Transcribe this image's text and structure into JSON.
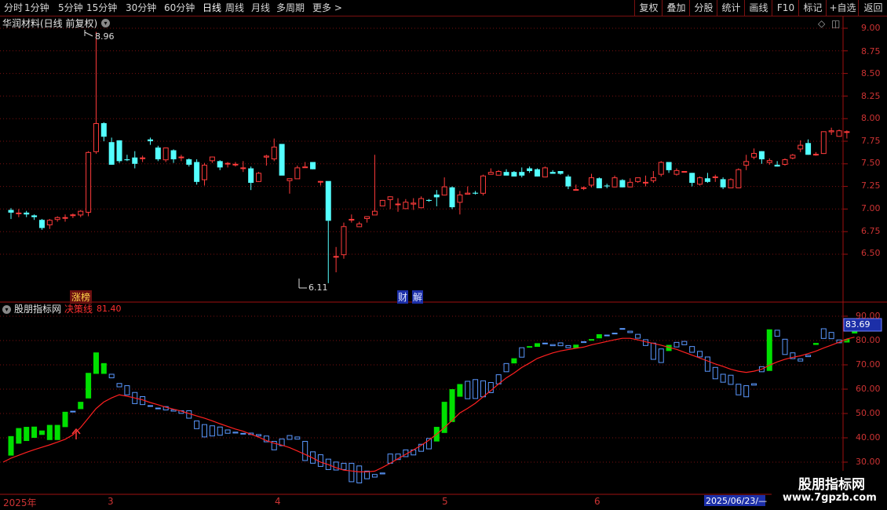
{
  "toolbar": {
    "periods": [
      "分时",
      "1分钟",
      "5分钟",
      "15分钟",
      "30分钟",
      "60分钟",
      "日线",
      "周线",
      "月线",
      "多周期",
      "更多 >"
    ],
    "active_period": "日线",
    "actions": [
      "复权",
      "叠加",
      "分股",
      "统计",
      "画线",
      "F10",
      "标记",
      "+自选",
      "返回"
    ]
  },
  "main_panel": {
    "title": "华润材料(日线 前复权)",
    "high_label": "8.96",
    "low_label": "6.11",
    "tag_limit": "涨榜",
    "tag_fin": "财",
    "tag_jie": "解"
  },
  "indicator_panel": {
    "name": "股朋指标网",
    "line_label": "决策线",
    "line_value": "81.40",
    "current_value": "83.69"
  },
  "price_axis": {
    "ticks": [
      "9.00",
      "8.75",
      "8.50",
      "8.25",
      "8.00",
      "7.75",
      "7.50",
      "7.25",
      "7.00",
      "6.75",
      "6.50"
    ]
  },
  "indicator_axis": {
    "ticks": [
      "90.00",
      "80.00",
      "70.00",
      "60.00",
      "50.00",
      "40.00",
      "30.00"
    ]
  },
  "date_axis": {
    "labels": [
      "2025年",
      "3",
      "4",
      "5",
      "6"
    ],
    "cursor_date": "2025/06/23/—"
  },
  "watermark": {
    "line1": "股朋指标网",
    "line2": "www.7gpzb.com"
  },
  "colors": {
    "up": "#ff3b3b",
    "down": "#54ffff",
    "grid": "#7a1010",
    "border": "#a01010",
    "decision_line": "#ff2020",
    "ind_up": "#5a98ff",
    "ind_down": "#00e000"
  },
  "chart_data": [
    {
      "type": "candlestick",
      "title": "华润材料(日线 前复权)",
      "ylim": [
        6.0,
        9.1
      ],
      "ohlc": [
        [
          6.99,
          6.96,
          6.89,
          7.01
        ],
        [
          6.95,
          6.96,
          6.91,
          7.0
        ],
        [
          6.96,
          6.94,
          6.91,
          6.98
        ],
        [
          6.93,
          6.91,
          6.88,
          6.94
        ],
        [
          6.88,
          6.79,
          6.77,
          6.89
        ],
        [
          6.82,
          6.88,
          6.78,
          6.89
        ],
        [
          6.88,
          6.91,
          6.86,
          6.92
        ],
        [
          6.91,
          6.91,
          6.86,
          6.94
        ],
        [
          6.94,
          6.94,
          6.9,
          6.95
        ],
        [
          6.93,
          6.98,
          6.91,
          6.99
        ],
        [
          6.96,
          7.63,
          6.92,
          7.64
        ],
        [
          7.63,
          7.95,
          7.61,
          8.96
        ],
        [
          7.95,
          7.8,
          7.75,
          7.96
        ],
        [
          7.74,
          7.49,
          7.49,
          7.79
        ],
        [
          7.76,
          7.53,
          7.51,
          7.76
        ],
        [
          7.55,
          7.54,
          7.53,
          7.6
        ],
        [
          7.57,
          7.5,
          7.45,
          7.64
        ],
        [
          7.56,
          7.57,
          7.52,
          7.59
        ],
        [
          7.77,
          7.75,
          7.71,
          7.79
        ],
        [
          7.68,
          7.55,
          7.53,
          7.7
        ],
        [
          7.54,
          7.68,
          7.52,
          7.68
        ],
        [
          7.65,
          7.55,
          7.51,
          7.66
        ],
        [
          7.58,
          7.58,
          7.53,
          7.6
        ],
        [
          7.55,
          7.49,
          7.47,
          7.56
        ],
        [
          7.52,
          7.3,
          7.27,
          7.55
        ],
        [
          7.32,
          7.49,
          7.26,
          7.51
        ],
        [
          7.53,
          7.58,
          7.51,
          7.58
        ],
        [
          7.53,
          7.46,
          7.43,
          7.54
        ],
        [
          7.5,
          7.51,
          7.46,
          7.52
        ],
        [
          7.5,
          7.5,
          7.47,
          7.52
        ],
        [
          7.45,
          7.46,
          7.41,
          7.53
        ],
        [
          7.45,
          7.29,
          7.21,
          7.47
        ],
        [
          7.3,
          7.4,
          7.3,
          7.41
        ],
        [
          7.57,
          7.59,
          7.48,
          7.6
        ],
        [
          7.55,
          7.69,
          7.53,
          7.78
        ],
        [
          7.72,
          7.37,
          7.38,
          7.72
        ],
        [
          7.31,
          7.34,
          7.17,
          7.31
        ],
        [
          7.33,
          7.46,
          7.34,
          7.48
        ],
        [
          7.47,
          7.47,
          7.47,
          7.52
        ],
        [
          7.52,
          7.44,
          7.44,
          7.5
        ],
        [
          7.31,
          7.31,
          7.26,
          7.31
        ],
        [
          7.31,
          6.87,
          6.18,
          6.87
        ],
        [
          6.48,
          6.48,
          6.3,
          6.58
        ],
        [
          6.49,
          6.81,
          6.45,
          6.85
        ],
        [
          6.88,
          6.89,
          6.85,
          6.94
        ],
        [
          6.8,
          6.84,
          6.8,
          6.86
        ],
        [
          6.89,
          6.92,
          6.85,
          6.92
        ],
        [
          6.93,
          6.98,
          6.95,
          7.6
        ],
        [
          7.03,
          7.1,
          7.07,
          7.1
        ],
        [
          7.1,
          7.14,
          7.0,
          7.14
        ],
        [
          7.06,
          7.06,
          6.97,
          7.12
        ],
        [
          7.0,
          7.08,
          7.0,
          7.11
        ],
        [
          7.05,
          7.07,
          6.99,
          7.12
        ],
        [
          7.01,
          7.12,
          7.01,
          7.14
        ],
        [
          7.1,
          7.09,
          7.08,
          7.11
        ],
        [
          7.16,
          7.13,
          7.03,
          7.21
        ],
        [
          7.15,
          7.25,
          7.15,
          7.35
        ],
        [
          7.24,
          7.02,
          7.0,
          7.25
        ],
        [
          7.07,
          7.16,
          6.94,
          7.2
        ],
        [
          7.16,
          7.18,
          7.16,
          7.25
        ],
        [
          7.18,
          7.17,
          7.16,
          7.2
        ],
        [
          7.17,
          7.37,
          7.15,
          7.38
        ],
        [
          7.38,
          7.41,
          7.38,
          7.45
        ],
        [
          7.37,
          7.42,
          7.39,
          7.43
        ],
        [
          7.41,
          7.37,
          7.39,
          7.44
        ],
        [
          7.41,
          7.36,
          7.36,
          7.42
        ],
        [
          7.41,
          7.37,
          7.35,
          7.46
        ],
        [
          7.45,
          7.42,
          7.4,
          7.47
        ],
        [
          7.44,
          7.36,
          7.36,
          7.45
        ],
        [
          7.35,
          7.46,
          7.35,
          7.47
        ],
        [
          7.41,
          7.39,
          7.39,
          7.43
        ],
        [
          7.42,
          7.39,
          7.38,
          7.42
        ],
        [
          7.36,
          7.25,
          7.22,
          7.38
        ],
        [
          7.22,
          7.22,
          7.22,
          7.27
        ],
        [
          7.23,
          7.24,
          7.21,
          7.25
        ],
        [
          7.26,
          7.35,
          7.24,
          7.39
        ],
        [
          7.34,
          7.23,
          7.24,
          7.35
        ],
        [
          7.26,
          7.25,
          7.23,
          7.28
        ],
        [
          7.24,
          7.35,
          7.24,
          7.37
        ],
        [
          7.32,
          7.24,
          7.24,
          7.33
        ],
        [
          7.24,
          7.3,
          7.24,
          7.34
        ],
        [
          7.3,
          7.35,
          7.29,
          7.34
        ],
        [
          7.29,
          7.3,
          7.25,
          7.37
        ],
        [
          7.31,
          7.35,
          7.29,
          7.42
        ],
        [
          7.38,
          7.52,
          7.36,
          7.53
        ],
        [
          7.52,
          7.43,
          7.4,
          7.52
        ],
        [
          7.38,
          7.43,
          7.37,
          7.45
        ],
        [
          7.42,
          7.42,
          7.43,
          7.43
        ],
        [
          7.4,
          7.29,
          7.25,
          7.4
        ],
        [
          7.27,
          7.35,
          7.26,
          7.36
        ],
        [
          7.34,
          7.3,
          7.29,
          7.4
        ],
        [
          7.36,
          7.36,
          7.3,
          7.38
        ],
        [
          7.33,
          7.24,
          7.22,
          7.35
        ],
        [
          7.23,
          7.33,
          7.24,
          7.34
        ],
        [
          7.23,
          7.44,
          7.23,
          7.45
        ],
        [
          7.48,
          7.53,
          7.43,
          7.6
        ],
        [
          7.57,
          7.62,
          7.55,
          7.67
        ],
        [
          7.64,
          7.55,
          7.5,
          7.64
        ],
        [
          7.51,
          7.54,
          7.49,
          7.56
        ],
        [
          7.49,
          7.47,
          7.47,
          7.53
        ],
        [
          7.49,
          7.55,
          7.48,
          7.56
        ],
        [
          7.56,
          7.6,
          7.55,
          7.61
        ],
        [
          7.66,
          7.71,
          7.63,
          7.76
        ],
        [
          7.73,
          7.6,
          7.6,
          7.77
        ],
        [
          7.61,
          7.61,
          7.59,
          7.63
        ],
        [
          7.61,
          7.86,
          7.61,
          7.86
        ],
        [
          7.85,
          7.87,
          7.82,
          7.9
        ],
        [
          7.8,
          7.87,
          7.8,
          7.88
        ],
        [
          7.86,
          7.86,
          7.78,
          7.87
        ]
      ]
    },
    {
      "type": "bar",
      "title": "股朋指标网",
      "ylim": [
        25,
        95
      ],
      "ticks": [
        30,
        40,
        50,
        60,
        70,
        80,
        90
      ],
      "bars": [
        [
          40.7,
          32.7
        ],
        [
          44.0,
          37.6
        ],
        [
          44.5,
          38.7
        ],
        [
          44.6,
          40.0
        ],
        [
          43.0,
          41.2
        ],
        [
          45.3,
          39.1
        ],
        [
          45.3,
          39.1
        ],
        [
          50.7,
          44.4
        ],
        [
          50.7,
          51.1
        ],
        [
          54.8,
          51.8
        ],
        [
          66.7,
          56.2
        ],
        [
          75.1,
          66.3
        ],
        [
          70.7,
          66.3
        ],
        [
          64.5,
          66.3
        ],
        [
          60.8,
          62.5
        ],
        [
          57.5,
          61.6
        ],
        [
          53.9,
          58.8
        ],
        [
          53.5,
          57.1
        ],
        [
          52.9,
          53.4
        ],
        [
          52.1,
          52.4
        ],
        [
          51.3,
          53.0
        ],
        [
          50.8,
          51.7
        ],
        [
          49.9,
          51.3
        ],
        [
          47.9,
          51.3
        ],
        [
          43.6,
          47.1
        ],
        [
          40.2,
          45.6
        ],
        [
          40.6,
          45.1
        ],
        [
          40.9,
          44.6
        ],
        [
          41.7,
          43.4
        ],
        [
          41.8,
          42.5
        ],
        [
          41.7,
          42.0
        ],
        [
          41.2,
          42.1
        ],
        [
          40.6,
          41.5
        ],
        [
          38.2,
          40.9
        ],
        [
          34.9,
          38.7
        ],
        [
          36.6,
          39.7
        ],
        [
          39.2,
          41.1
        ],
        [
          39.3,
          40.5
        ],
        [
          30.5,
          38.7
        ],
        [
          29.4,
          34.4
        ],
        [
          28.1,
          33.2
        ],
        [
          26.8,
          31.4
        ],
        [
          26.6,
          30.2
        ],
        [
          26.8,
          29.7
        ],
        [
          21.8,
          29.7
        ],
        [
          21.3,
          28.6
        ],
        [
          23.0,
          26.5
        ],
        [
          23.7,
          25.1
        ],
        [
          25.0,
          25.7
        ],
        [
          29.4,
          33.5
        ],
        [
          30.9,
          33.5
        ],
        [
          32.1,
          35.2
        ],
        [
          32.8,
          35.2
        ],
        [
          34.3,
          37.5
        ],
        [
          35.3,
          39.9
        ],
        [
          44.5,
          38.5
        ],
        [
          54.8,
          42.0
        ],
        [
          60.0,
          46.5
        ],
        [
          62.1,
          56.9
        ],
        [
          55.9,
          63.4
        ],
        [
          56.0,
          64.1
        ],
        [
          56.7,
          63.6
        ],
        [
          58.4,
          62.9
        ],
        [
          62.0,
          66.1
        ],
        [
          67.0,
          70.7
        ],
        [
          72.7,
          70.6
        ],
        [
          73.0,
          77.2
        ],
        [
          77.7,
          77.4
        ],
        [
          78.9,
          77.4
        ],
        [
          78.9,
          79.1
        ],
        [
          77.7,
          78.5
        ],
        [
          77.7,
          79.2
        ],
        [
          76.9,
          78.1
        ],
        [
          78.3,
          76.9
        ],
        [
          79.0,
          79.7
        ],
        [
          80.6,
          80.1
        ],
        [
          82.6,
          80.9
        ],
        [
          82.4,
          82.4
        ],
        [
          83.2,
          83.2
        ],
        [
          84.8,
          85.1
        ],
        [
          83.1,
          84.0
        ],
        [
          80.8,
          82.7
        ],
        [
          77.8,
          80.5
        ],
        [
          72.1,
          79.1
        ],
        [
          70.8,
          76.7
        ],
        [
          78.2,
          75.7
        ],
        [
          77.2,
          79.4
        ],
        [
          78.1,
          79.8
        ],
        [
          75.0,
          77.7
        ],
        [
          73.1,
          75.7
        ],
        [
          67.2,
          73.4
        ],
        [
          64.1,
          69.1
        ],
        [
          62.7,
          66.3
        ],
        [
          61.8,
          65.9
        ],
        [
          57.5,
          62.2
        ],
        [
          56.7,
          61.6
        ],
        [
          61.5,
          62.4
        ],
        [
          67.0,
          69.4
        ],
        [
          84.6,
          67.5
        ],
        [
          81.6,
          84.4
        ],
        [
          74.1,
          80.7
        ],
        [
          72.4,
          75.1
        ],
        [
          71.4,
          72.6
        ],
        [
          73.2,
          74.1
        ],
        [
          79.0,
          78.2
        ],
        [
          80.7,
          85.0
        ],
        [
          80.6,
          83.5
        ],
        [
          78.9,
          80.4
        ],
        [
          80.6,
          79.2
        ],
        [
          84.8,
          82.9
        ],
        [
          84.1,
          87.5
        ],
        [
          87.4,
          87.6
        ],
        [
          88.3,
          87.5
        ]
      ],
      "decision_line": [
        30.0,
        31.6,
        32.8,
        34.0,
        35.1,
        36.1,
        37.1,
        38.2,
        39.4,
        41.2,
        44.2,
        48.1,
        52.0,
        54.7,
        56.4,
        57.7,
        57.1,
        56.4,
        55.6,
        54.5,
        53.6,
        52.6,
        51.8,
        51.0,
        50.0,
        49.0,
        48.1,
        47.0,
        45.8,
        44.7,
        43.6,
        42.7,
        41.5,
        40.3,
        38.9,
        37.8,
        37.0,
        36.0,
        34.6,
        33.2,
        31.7,
        30.0,
        29.0,
        27.7,
        26.7,
        26.4,
        26.0,
        26.0,
        26.3,
        27.8,
        29.5,
        31.4,
        33.2,
        35.0,
        36.9,
        39.0,
        41.5,
        44.2,
        47.1,
        50.2,
        52.1,
        54.2,
        56.8,
        59.4,
        62.1,
        64.6,
        66.6,
        68.9,
        70.7,
        72.6,
        73.8,
        74.9,
        75.7,
        76.3,
        76.8,
        77.3,
        78.2,
        78.9,
        79.6,
        80.3,
        80.9,
        80.9,
        80.3,
        79.5,
        78.8,
        78.1,
        77.2,
        76.4,
        75.2,
        74.0,
        72.8,
        71.6,
        70.4,
        69.4,
        68.2,
        67.4,
        66.9,
        67.4,
        68.2,
        69.8,
        71.2,
        72.3,
        73.1,
        73.7,
        74.6,
        75.6,
        76.9,
        78.1,
        79.3,
        80.6,
        81.4
      ]
    }
  ]
}
